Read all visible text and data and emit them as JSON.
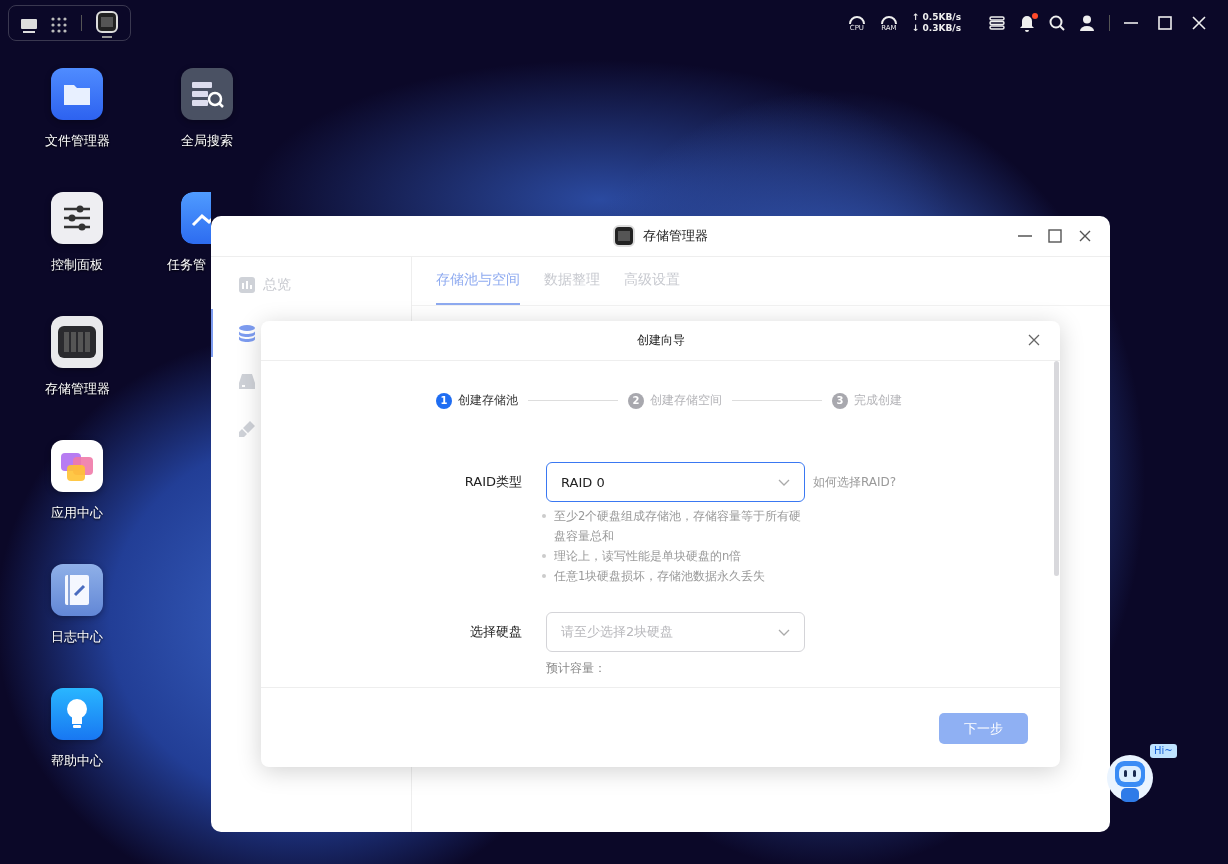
{
  "dock": [
    {
      "kind": "desktop",
      "active": false
    },
    {
      "kind": "launcher",
      "active": false
    },
    {
      "kind": "storage",
      "active": true
    }
  ],
  "tray": {
    "cpu_label": "CPU",
    "ram_label": "RAM",
    "upload": "↑ 0.5KB/s",
    "download": "↓ 0.3KB/s",
    "unread_notifications": true
  },
  "desktop_columns": [
    [
      {
        "kind": "files",
        "label": "文件管理器"
      },
      {
        "kind": "control",
        "label": "控制面板"
      },
      {
        "kind": "storage",
        "label": "存储管理器"
      },
      {
        "kind": "apps",
        "label": "应用中心"
      },
      {
        "kind": "log",
        "label": "日志中心"
      },
      {
        "kind": "help",
        "label": "帮助中心"
      }
    ],
    [
      {
        "kind": "search",
        "label": "全局搜索"
      },
      {
        "kind": "tasks",
        "label": "任务管"
      }
    ]
  ],
  "window": {
    "title": "存储管理器",
    "sidebar": [
      {
        "kind": "overview",
        "label": "总览",
        "selected": false
      },
      {
        "kind": "storage",
        "selected": true
      },
      {
        "kind": "drive",
        "selected": false
      },
      {
        "kind": "brush",
        "selected": false
      }
    ],
    "tabs": [
      {
        "label": "存储池与空间",
        "selected": true
      },
      {
        "label": "数据整理",
        "selected": false
      },
      {
        "label": "高级设置",
        "selected": false
      }
    ]
  },
  "dialog": {
    "title": "创建向导",
    "steps": [
      {
        "number": "1",
        "label": "创建存储池",
        "active": true
      },
      {
        "number": "2",
        "label": "创建存储空间",
        "active": false
      },
      {
        "number": "3",
        "label": "完成创建",
        "active": false
      }
    ],
    "fields": [
      {
        "label": "RAID类型",
        "value": "RAID 0",
        "focused": true,
        "help_link": "如何选择RAID?",
        "notes": [
          "至少2个硬盘组成存储池，存储容量等于所有硬盘容量总和",
          "理论上，读写性能是单块硬盘的n倍",
          "任意1块硬盘损坏，存储池数据永久丢失"
        ]
      },
      {
        "label": "选择硬盘",
        "placeholder": "请至少选择2块硬盘",
        "focused": false,
        "hint": "预计容量："
      }
    ],
    "next_button": {
      "label": "下一步",
      "disabled": true
    }
  },
  "assistant": {
    "bubble": "Hi~"
  }
}
